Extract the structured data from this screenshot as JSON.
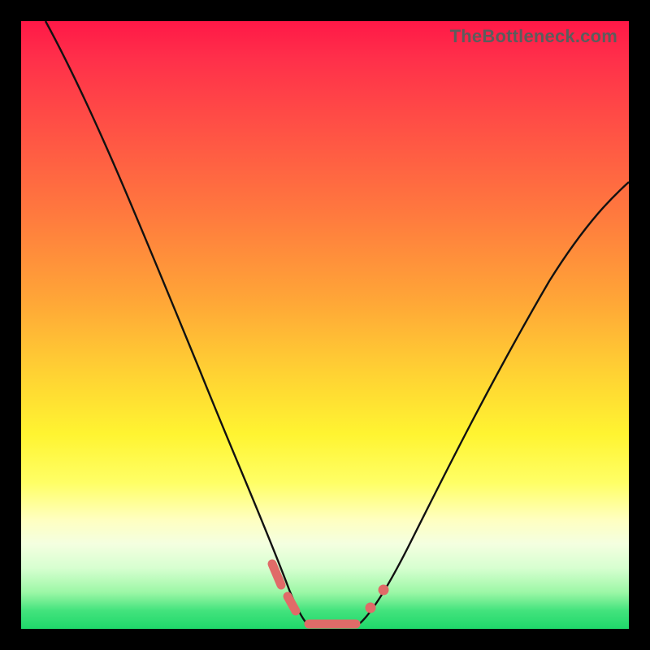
{
  "watermark": "TheBottleneck.com",
  "colors": {
    "gradient_top": "#ff1847",
    "gradient_mid": "#fff431",
    "gradient_bottom": "#1fd86a",
    "curve": "#111111",
    "bead": "#e06b68",
    "frame": "#000000"
  },
  "chart_data": {
    "type": "line",
    "title": "",
    "xlabel": "",
    "ylabel": "",
    "xlim": [
      0,
      100
    ],
    "ylim": [
      0,
      100
    ],
    "note": "No axis ticks or labels are visible. Values are estimated from pixel positions as percentages of the plot area (x: 0=left, 100=right; y: 0=bottom, 100=top).",
    "series": [
      {
        "name": "left-branch",
        "x": [
          4,
          10,
          15,
          20,
          25,
          30,
          34,
          37,
          40,
          42,
          44,
          46
        ],
        "y": [
          100,
          83,
          69,
          56,
          44,
          32,
          22,
          15,
          9,
          5,
          3,
          1
        ]
      },
      {
        "name": "right-branch",
        "x": [
          56,
          58,
          61,
          65,
          70,
          76,
          83,
          90,
          97,
          100
        ],
        "y": [
          1,
          3,
          6,
          11,
          19,
          30,
          43,
          56,
          69,
          74
        ]
      },
      {
        "name": "flat-bottom",
        "x": [
          46,
          48,
          50,
          52,
          54,
          56
        ],
        "y": [
          0.5,
          0.3,
          0.3,
          0.3,
          0.3,
          0.5
        ]
      }
    ],
    "markers": [
      {
        "name": "bead-left-upper",
        "shape": "pill",
        "x0": 41.0,
        "y0": 10.5,
        "x1": 42.5,
        "y1": 7.0
      },
      {
        "name": "bead-left-lower",
        "shape": "pill",
        "x0": 43.5,
        "y0": 5.0,
        "x1": 44.7,
        "y1": 3.0
      },
      {
        "name": "bead-bottom",
        "shape": "pill",
        "x0": 47.0,
        "y0": 0.7,
        "x1": 55.0,
        "y1": 0.7
      },
      {
        "name": "bead-right-lower",
        "shape": "dot",
        "x": 57.5,
        "y": 3.5,
        "r": 1.2
      },
      {
        "name": "bead-right-upper",
        "shape": "dot",
        "x": 59.5,
        "y": 6.5,
        "r": 1.2
      }
    ]
  }
}
